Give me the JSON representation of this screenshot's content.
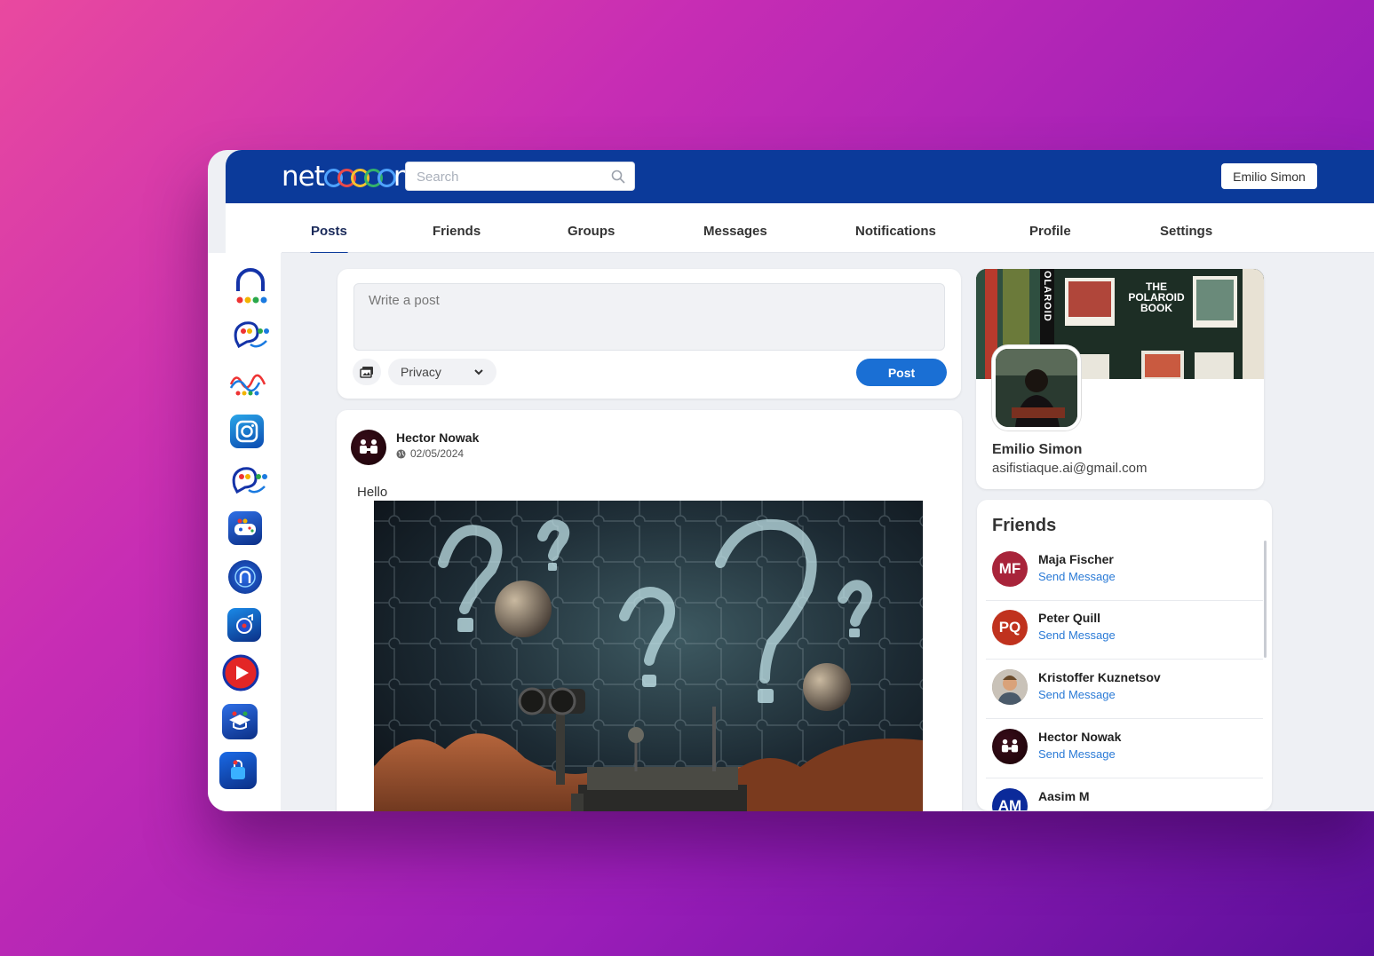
{
  "app": {
    "logo_prefix": "net",
    "logo_suffix": "n"
  },
  "search": {
    "placeholder": "Search"
  },
  "user_button": "Emilio Simon",
  "tabs": [
    {
      "label": "Posts",
      "active": true
    },
    {
      "label": "Friends"
    },
    {
      "label": "Groups"
    },
    {
      "label": "Messages"
    },
    {
      "label": "Notifications"
    },
    {
      "label": "Profile"
    },
    {
      "label": "Settings"
    }
  ],
  "composer": {
    "placeholder": "Write a post",
    "privacy": "Privacy",
    "post_button": "Post"
  },
  "post": {
    "author": "Hector Nowak",
    "date": "02/05/2024",
    "text": "Hello"
  },
  "profile": {
    "name": "Emilio Simon",
    "email": "asifistiaque.ai@gmail.com",
    "cover_text": [
      "THE",
      "POLAROID",
      "BOOK"
    ],
    "cover_side_text": "OLAROID"
  },
  "friends": {
    "title": "Friends",
    "action": "Send Message",
    "items": [
      {
        "name": "Maja Fischer",
        "initials": "MF",
        "color": "#a8243a"
      },
      {
        "name": "Peter Quill",
        "initials": "PQ",
        "color": "#c0321e"
      },
      {
        "name": "Kristoffer Kuznetsov",
        "initials": "",
        "color": "#8a7a6a"
      },
      {
        "name": "Hector Nowak",
        "initials": "",
        "color": "#2a0610"
      },
      {
        "name": "Aasim M",
        "initials": "AM",
        "color": "#0b2a9a"
      }
    ]
  },
  "colors": {
    "brand": "#0b3a9a",
    "accent": "#1a6fd4",
    "link": "#2a7ad6"
  }
}
